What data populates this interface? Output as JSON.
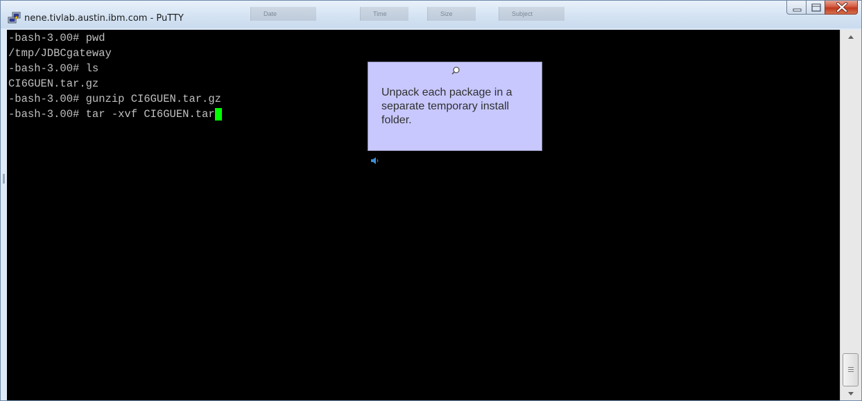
{
  "window": {
    "title": "nene.tivlab.austin.ibm.com - PuTTY",
    "app_icon": "putty-icon"
  },
  "background_columns": [
    "Date",
    "Time",
    "Size",
    "Subject"
  ],
  "controls": {
    "minimize_icon": "minimize-icon",
    "maximize_icon": "maximize-icon",
    "close_icon": "close-icon"
  },
  "terminal": {
    "lines": [
      "-bash-3.00# pwd",
      "/tmp/JDBCgateway",
      "-bash-3.00# ls",
      "CI6GUEN.tar.gz",
      "-bash-3.00# gunzip CI6GUEN.tar.gz",
      "-bash-3.00# tar -xvf CI6GUEN.tar"
    ],
    "text_color": "#c0c0c0",
    "background_color": "#000000",
    "cursor_color": "#00ff00"
  },
  "callout": {
    "text": "Unpack each package in a separate temporary install folder.",
    "background_color": "#c8c8ff",
    "icon": "magnifier-icon",
    "audio_icon": "speaker-icon"
  },
  "scrollbar": {
    "up_icon": "scroll-up-arrow-icon",
    "down_icon": "scroll-down-arrow-icon"
  }
}
